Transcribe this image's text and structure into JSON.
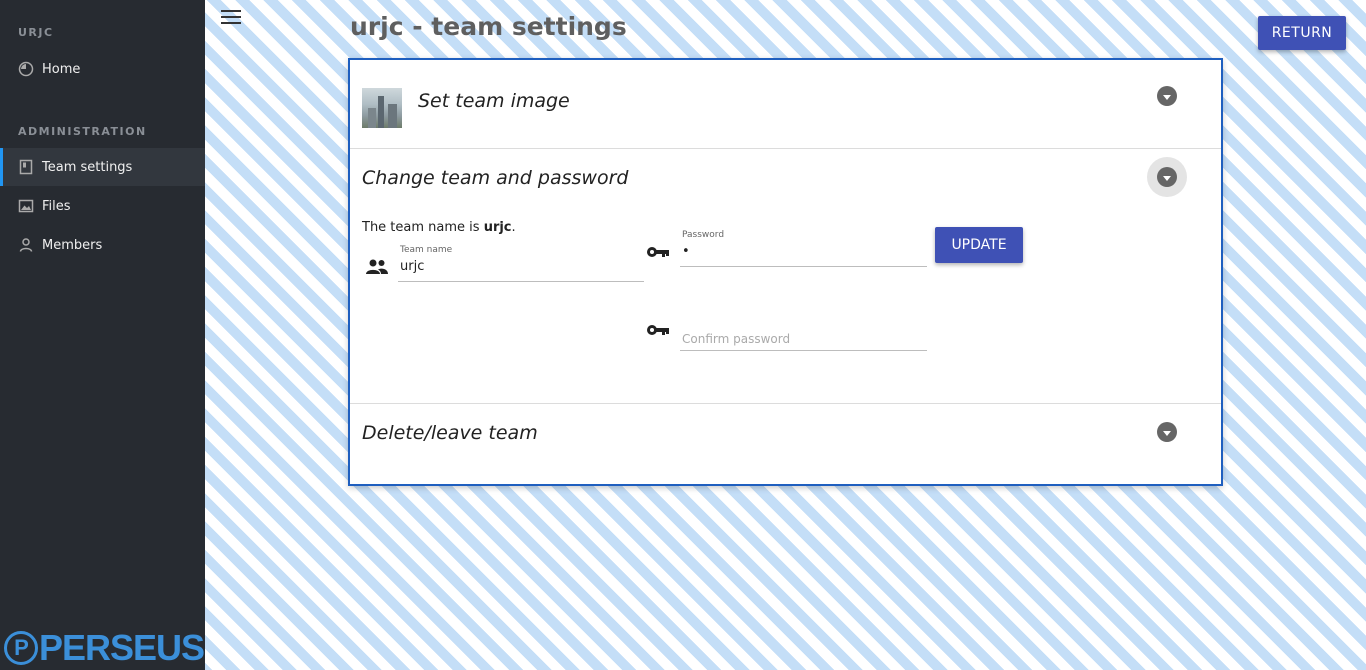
{
  "sidebar": {
    "team_section": "URJC",
    "home_label": "Home",
    "admin_section": "ADMINISTRATION",
    "items": [
      {
        "label": "Team settings"
      },
      {
        "label": "Files"
      },
      {
        "label": "Members"
      }
    ],
    "logo_letter": "P",
    "logo_text": "PERSEUS"
  },
  "header": {
    "title": "urjc - team settings",
    "return_label": "RETURN"
  },
  "panels": {
    "image": {
      "title": "Set team image"
    },
    "password": {
      "title": "Change team and password",
      "team_prefix": "The team name is ",
      "team_name_bold": "urjc",
      "team_suffix": ".",
      "team_name_label": "Team name",
      "team_name_value": "urjc",
      "password_label": "Password",
      "password_value": "•",
      "confirm_placeholder": "Confirm password",
      "update_label": "UPDATE"
    },
    "delete": {
      "title": "Delete/leave team"
    }
  },
  "colors": {
    "accent": "#3f51b5",
    "sidebar_bg": "#272b31",
    "active_indicator": "#2196f3",
    "logo": "#3b8fd9"
  }
}
